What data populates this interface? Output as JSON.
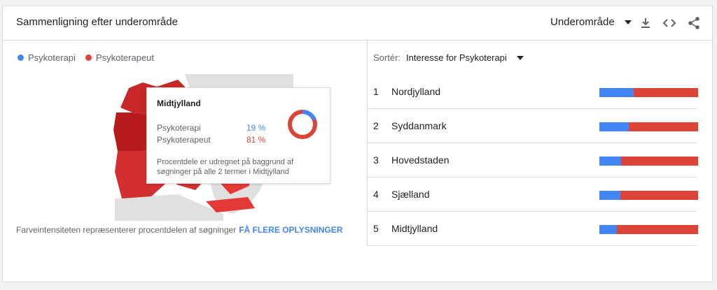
{
  "header": {
    "title": "Sammenligning efter underområde",
    "region_select": "Underområde",
    "icons": [
      "download-icon",
      "embed-icon",
      "share-icon"
    ]
  },
  "legend": [
    {
      "label": "Psykoterapi",
      "color": "#4285f4"
    },
    {
      "label": "Psykoterapeut",
      "color": "#db4437"
    }
  ],
  "tooltip": {
    "title": "Midtjylland",
    "rows": [
      {
        "label": "Psykoterapi",
        "value": "19 %",
        "fraction": 0.19,
        "color": "#4285f4"
      },
      {
        "label": "Psykoterapeut",
        "value": "81 %",
        "fraction": 0.81,
        "color": "#db4437"
      }
    ],
    "note": "Procentdele er udregnet på baggrund af søgninger på alle 2 termer i Midtjylland"
  },
  "footnote": {
    "text": "Farveintensiteten repræsenterer procentdelen af søgninger",
    "link": "FÅ FLERE OPLYSNINGER"
  },
  "sort": {
    "label": "Sortér:",
    "value": "Interesse for Psykoterapi"
  },
  "regions": [
    {
      "rank": "1",
      "name": "Nordjylland",
      "share_psykoterapi": 0.35
    },
    {
      "rank": "2",
      "name": "Syddanmark",
      "share_psykoterapi": 0.3
    },
    {
      "rank": "3",
      "name": "Hovedstaden",
      "share_psykoterapi": 0.22
    },
    {
      "rank": "4",
      "name": "Sjælland",
      "share_psykoterapi": 0.21
    },
    {
      "rank": "5",
      "name": "Midtjylland",
      "share_psykoterapi": 0.18
    }
  ]
}
